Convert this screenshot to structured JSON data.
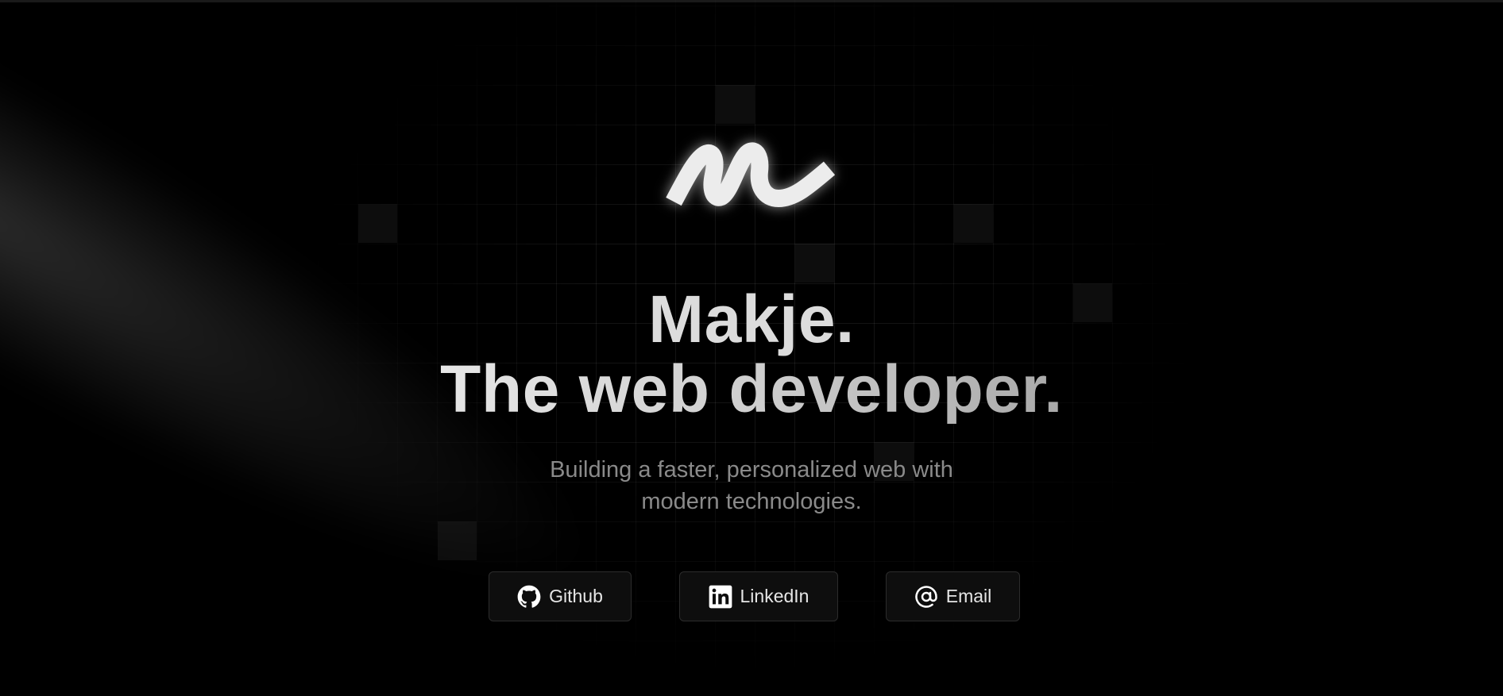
{
  "hero": {
    "title_line1": "Makje.",
    "title_line2": "The web developer.",
    "subtitle_line1": "Building a faster, personalized web with",
    "subtitle_line2": "modern technologies."
  },
  "links": {
    "github": {
      "label": "Github",
      "icon": "github-icon"
    },
    "linkedin": {
      "label": "LinkedIn",
      "icon": "linkedin-icon"
    },
    "email": {
      "label": "Email",
      "icon": "at-sign-icon"
    }
  },
  "colors": {
    "background": "#000000",
    "title": "#dcdcdc",
    "subtitle": "#8a8a8a",
    "button_bg": "#0e0e0e",
    "button_border": "#2c2c2c",
    "button_text": "#e6e6e6"
  }
}
